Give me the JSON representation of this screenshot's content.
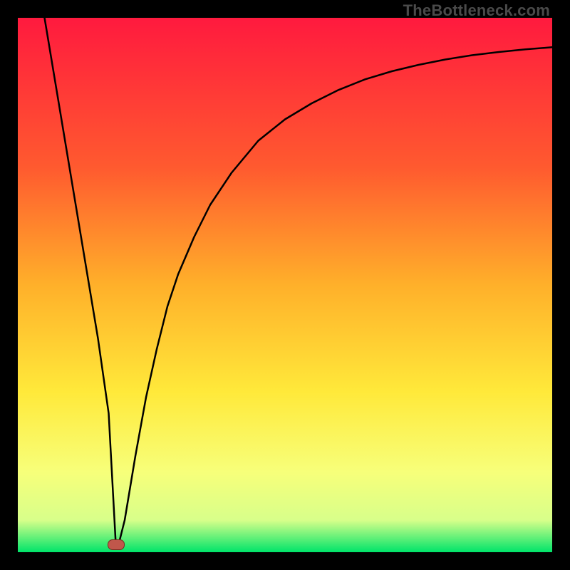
{
  "watermark": "TheBottleneck.com",
  "chart_data": {
    "type": "line",
    "title": "",
    "xlabel": "",
    "ylabel": "",
    "xlim": [
      0,
      100
    ],
    "ylim": [
      0,
      100
    ],
    "grid": false,
    "legend": false,
    "background_gradient": {
      "top": "#ff1a3e",
      "mid1": "#ff8a2a",
      "mid2": "#ffe93a",
      "mid3": "#f7ff7a",
      "bottom": "#00e46a"
    },
    "series": [
      {
        "name": "bottleneck-curve",
        "color": "#000000",
        "x": [
          5,
          7,
          9,
          11,
          13,
          15,
          17,
          18.3,
          19,
          20,
          22,
          24,
          26,
          28,
          30,
          33,
          36,
          40,
          45,
          50,
          55,
          60,
          65,
          70,
          75,
          80,
          85,
          90,
          95,
          100
        ],
        "y": [
          100,
          88,
          76,
          64,
          52,
          40,
          26,
          2,
          2,
          6,
          18,
          29,
          38,
          46,
          52,
          59,
          65,
          71,
          77,
          81,
          84,
          86.5,
          88.5,
          90,
          91.2,
          92.2,
          93,
          93.6,
          94.1,
          94.5
        ]
      }
    ],
    "marker": {
      "name": "optimal-point",
      "x": 18.3,
      "y": 1.5,
      "color": "#c0574b"
    }
  }
}
